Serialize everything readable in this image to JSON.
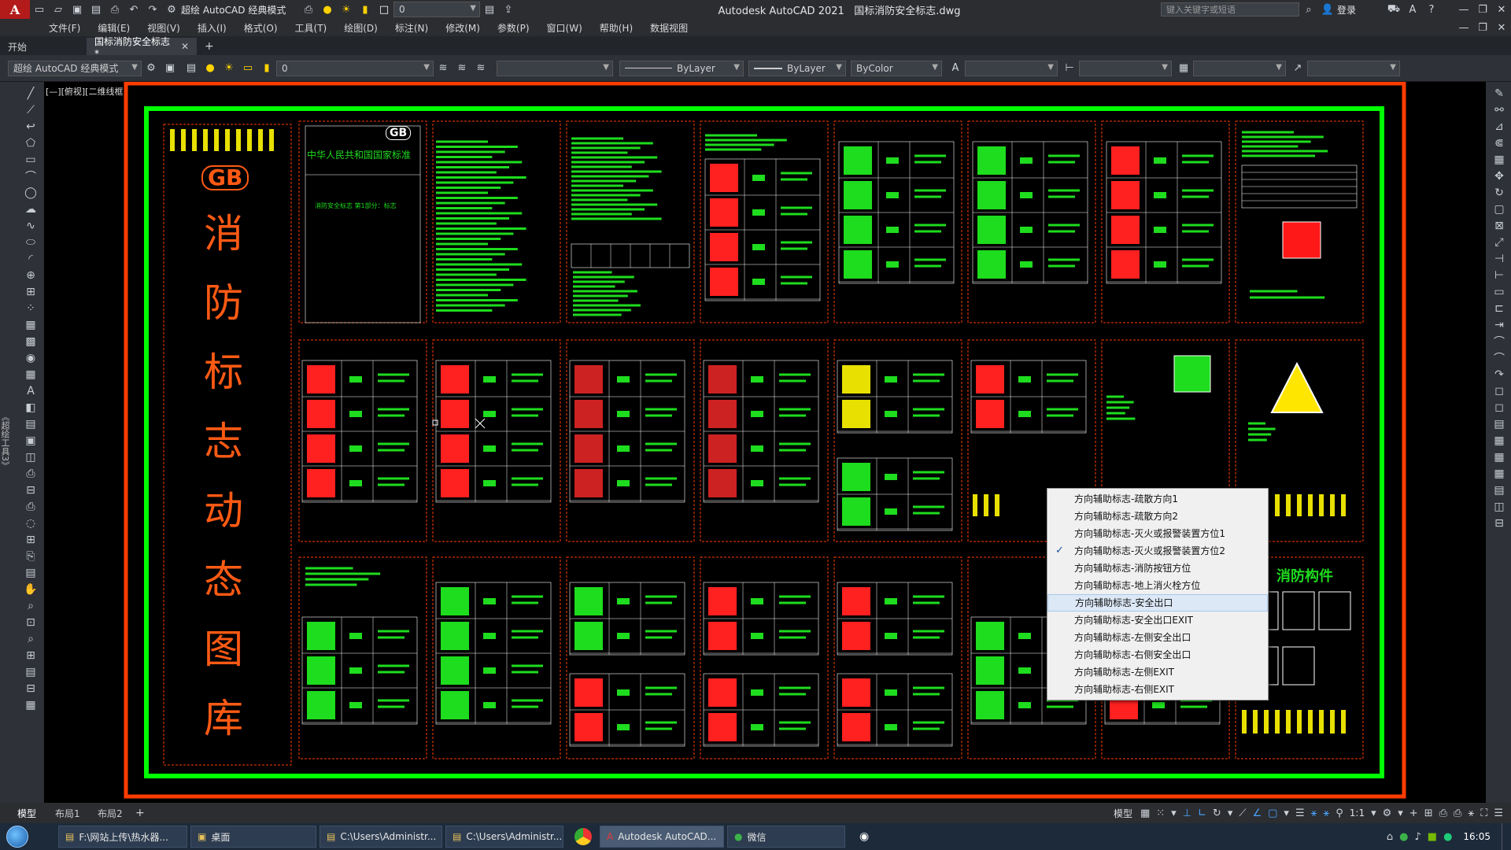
{
  "app": {
    "title": "Autodesk AutoCAD 2021",
    "filename": "国标消防安全标志.dwg",
    "workspace": "超绘 AutoCAD 经典模式",
    "layer_value": "0",
    "search_placeholder": "键入关键字或短语",
    "login_label": "登录"
  },
  "menu": [
    "文件(F)",
    "编辑(E)",
    "视图(V)",
    "插入(I)",
    "格式(O)",
    "工具(T)",
    "绘图(D)",
    "标注(N)",
    "修改(M)",
    "参数(P)",
    "窗口(W)",
    "帮助(H)",
    "数据视图"
  ],
  "tabs": {
    "start": "开始",
    "document": "国标消防安全标志*"
  },
  "toolbar": {
    "workspace": "超绘 AutoCAD 经典模式",
    "layer": "0",
    "linetype1": "ByLayer",
    "linetype2": "ByLayer",
    "color": "ByColor"
  },
  "viewport_label": "[—][俯视][二维线框]",
  "side_label": "《超绘工具3》",
  "drawing": {
    "title_chars": [
      "消",
      "防",
      "标",
      "志",
      "动",
      "态",
      "图",
      "库"
    ],
    "gb_logo": "GB",
    "std_title": "中华人民共和国国家标准",
    "std_subtitle": "消防安全标志 第1部分：标志",
    "component_title": "消防构件"
  },
  "context_menu": {
    "items": [
      {
        "label": "方向辅助标志-疏散方向1",
        "checked": false
      },
      {
        "label": "方向辅助标志-疏散方向2",
        "checked": false
      },
      {
        "label": "方向辅助标志-灭火或报警装置方位1",
        "checked": false
      },
      {
        "label": "方向辅助标志-灭火或报警装置方位2",
        "checked": true
      },
      {
        "label": "方向辅助标志-消防按钮方位",
        "checked": false
      },
      {
        "label": "方向辅助标志-地上消火栓方位",
        "checked": false
      },
      {
        "label": "方向辅助标志-安全出口",
        "checked": false
      },
      {
        "label": "方向辅助标志-安全出口EXIT",
        "checked": false
      },
      {
        "label": "方向辅助标志-左侧安全出口",
        "checked": false
      },
      {
        "label": "方向辅助标志-右侧安全出口",
        "checked": false
      },
      {
        "label": "方向辅助标志-左侧EXIT",
        "checked": false
      },
      {
        "label": "方向辅助标志-右侧EXIT",
        "checked": false
      }
    ],
    "hover_index": 6
  },
  "layout_tabs": [
    "模型",
    "布局1",
    "布局2"
  ],
  "status": {
    "model": "模型",
    "scale": "1:1",
    "time": "16:05"
  },
  "taskbar": [
    {
      "label": "F:\\网站上传\\热水器...",
      "active": false
    },
    {
      "label": "桌面",
      "active": false
    },
    {
      "label": "C:\\Users\\Administr...",
      "active": false
    },
    {
      "label": "C:\\Users\\Administr...",
      "active": false
    },
    {
      "label": "Autodesk AutoCAD...",
      "active": true
    },
    {
      "label": "微信",
      "active": false
    }
  ],
  "colors": {
    "border_red": "#ff3c00",
    "border_green": "#00ff00",
    "sign_red": "#ff2020",
    "sign_green": "#1edc1e",
    "accent_title": "#ff5a14"
  }
}
